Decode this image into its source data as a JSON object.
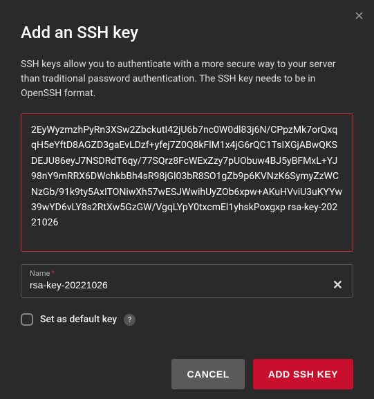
{
  "dialog": {
    "title": "Add an SSH key",
    "description": "SSH keys allow you to authenticate with a more secure way to your server than traditional password authentication. The SSH key needs to be in OpenSSH format.",
    "key_value": "2EyWyzmzhPyRn3XSw2ZbckutI42jU6b7nc0W0dl83j6N/CPpzMk7orQxqqH5eYftD8AGZD3gaEvLDzf+yfej7Z0Q8kFlM1x4jG6rQC1TsIXGjABwQKSDEJU86eyJ7NSDRdT6qy/77SQrz8FcWExZzy7pUObuw4BJ5yBFMxL+YJ98nY9mRRX6DWchkbBh4sR98jGl03bR8SO1gZb9p6KVNzK6SymyZzWCNzGb/91k9ty5AxITONiwXh57wESJWwihUyZOb6xpw+AKuHVviU3uKYYw39wYD6vLY8s2RtXw5GzGW/VgqLYpY0txcmEl1yhskPoxgxp rsa-key-20221026",
    "name_label": "Name",
    "name_value": "rsa-key-20221026",
    "default_label": "Set as default key",
    "cancel_label": "CANCEL",
    "submit_label": "ADD SSH KEY"
  }
}
